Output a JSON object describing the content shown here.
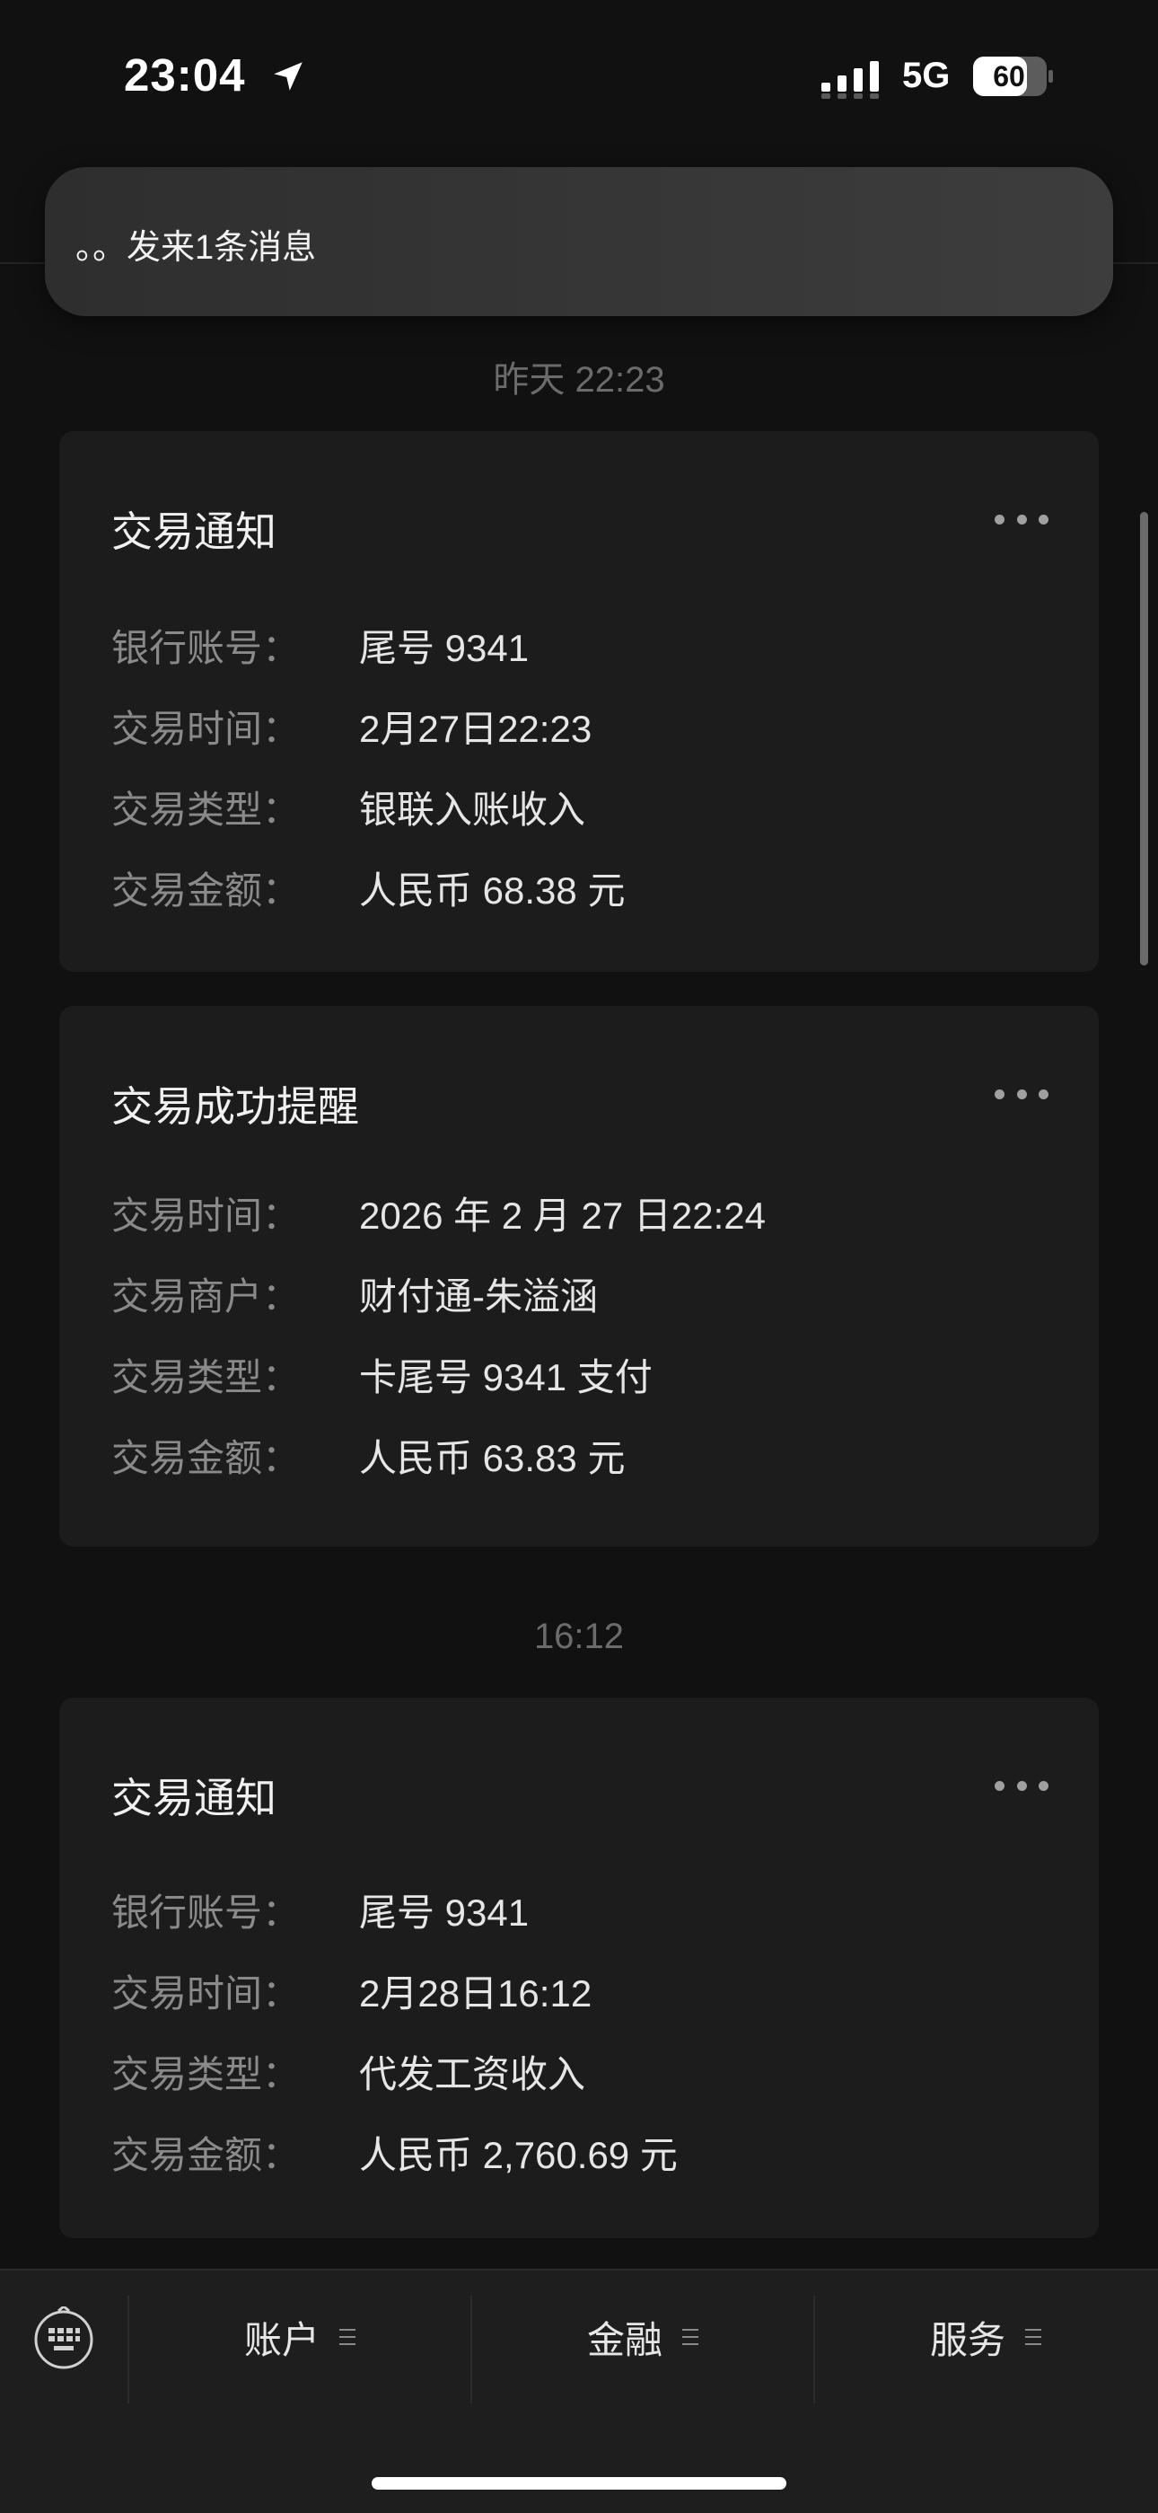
{
  "status": {
    "time": "23:04",
    "network": "5G",
    "battery": "60"
  },
  "banner": {
    "text": "。。发来1条消息"
  },
  "timestamps": {
    "first": "昨天 22:23",
    "second": "16:12"
  },
  "cards": [
    {
      "title": "交易通知",
      "rows": [
        {
          "label": "银行账号：",
          "value": "尾号 9341"
        },
        {
          "label": "交易时间：",
          "value": "2月27日22:23"
        },
        {
          "label": "交易类型：",
          "value": "银联入账收入"
        },
        {
          "label": "交易金额：",
          "value": "人民币 68.38 元"
        }
      ]
    },
    {
      "title": "交易成功提醒",
      "rows": [
        {
          "label": "交易时间：",
          "value": "2026 年 2 月 27 日22:24"
        },
        {
          "label": "交易商户：",
          "value": "财付通-朱溢涵"
        },
        {
          "label": "交易类型：",
          "value": "卡尾号 9341 支付"
        },
        {
          "label": "交易金额：",
          "value": "人民币 63.83 元"
        }
      ]
    },
    {
      "title": "交易通知",
      "rows": [
        {
          "label": "银行账号：",
          "value": "尾号 9341"
        },
        {
          "label": "交易时间：",
          "value": "2月28日16:12"
        },
        {
          "label": "交易类型：",
          "value": "代发工资收入"
        },
        {
          "label": "交易金额：",
          "value": "人民币 2,760.69 元"
        }
      ]
    }
  ],
  "tabbar": {
    "tabs": [
      {
        "label": "账户"
      },
      {
        "label": "金融"
      },
      {
        "label": "服务"
      }
    ]
  },
  "icons": {
    "location": "location-arrow-icon",
    "signal": "cellular-signal-icon",
    "battery": "battery-icon",
    "keyboard": "keyboard-icon",
    "more": "more-dots-icon",
    "menu": "menu-lines-icon"
  }
}
